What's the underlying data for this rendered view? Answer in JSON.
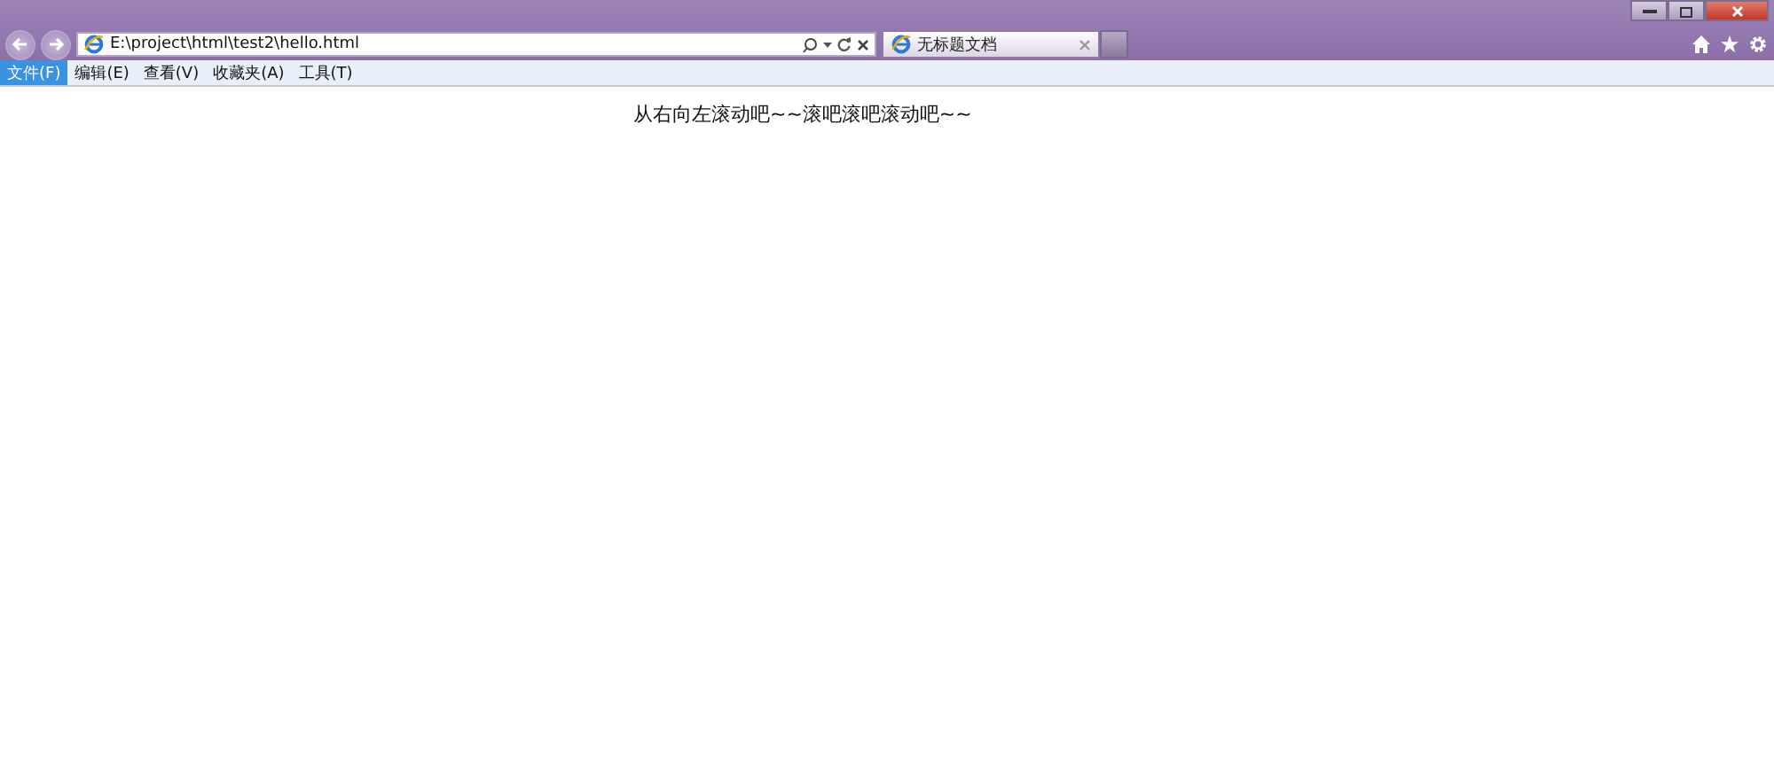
{
  "address_bar": {
    "value": "E:\\project\\html\\test2\\hello.html"
  },
  "tabs": [
    {
      "label": "无标题文档",
      "selected": true
    }
  ],
  "menu_bar": [
    {
      "label": "文件(F)",
      "selected": true
    },
    {
      "label": "编辑(E)",
      "selected": false
    },
    {
      "label": "查看(V)",
      "selected": false
    },
    {
      "label": "收藏夹(A)",
      "selected": false
    },
    {
      "label": "工具(T)",
      "selected": false
    }
  ],
  "page": {
    "marquee_text": "从右向左滚动吧~~滚吧滚吧滚动吧~~"
  }
}
